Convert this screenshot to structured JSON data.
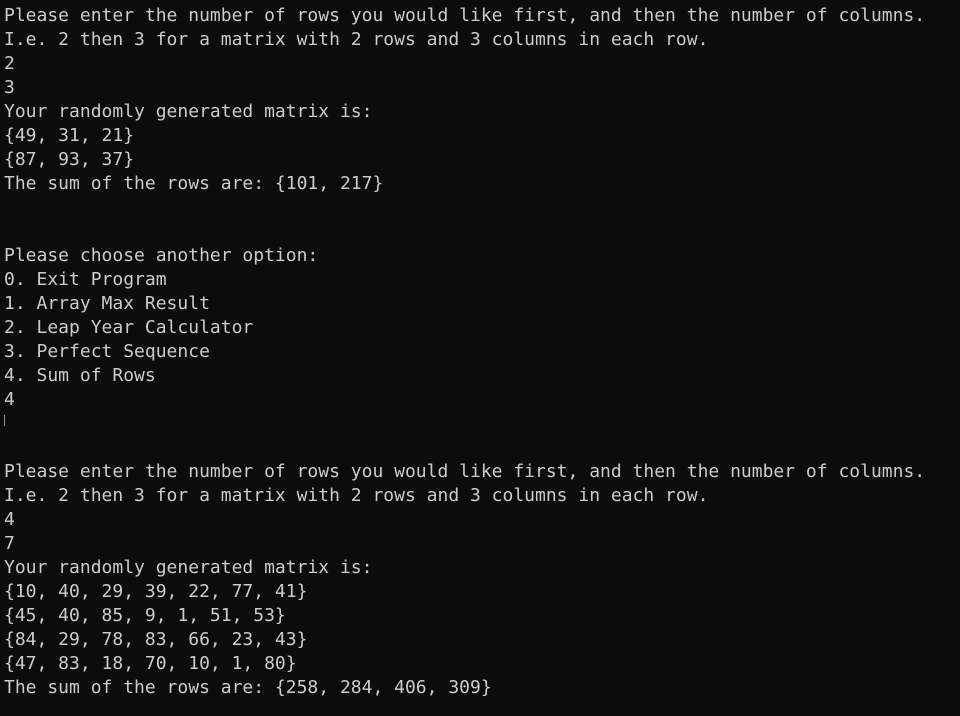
{
  "console": {
    "lines": [
      "Please enter the number of rows you would like first, and then the number of columns.",
      "I.e. 2 then 3 for a matrix with 2 rows and 3 columns in each row.",
      "2",
      "3",
      "Your randomly generated matrix is:",
      "{49, 31, 21}",
      "{87, 93, 37}",
      "The sum of the rows are: {101, 217}",
      "",
      "",
      "Please choose another option:",
      "0. Exit Program",
      "1. Array Max Result",
      "2. Leap Year Calculator",
      "3. Perfect Sequence",
      "4. Sum of Rows",
      "4",
      "",
      "",
      "Please enter the number of rows you would like first, and then the number of columns.",
      "I.e. 2 then 3 for a matrix with 2 rows and 3 columns in each row.",
      "4",
      "7",
      "Your randomly generated matrix is:",
      "{10, 40, 29, 39, 22, 77, 41}",
      "{45, 40, 85, 9, 1, 51, 53}",
      "{84, 29, 78, 83, 66, 23, 43}",
      "{47, 83, 18, 70, 10, 1, 80}",
      "The sum of the rows are: {258, 284, 406, 309}"
    ]
  }
}
